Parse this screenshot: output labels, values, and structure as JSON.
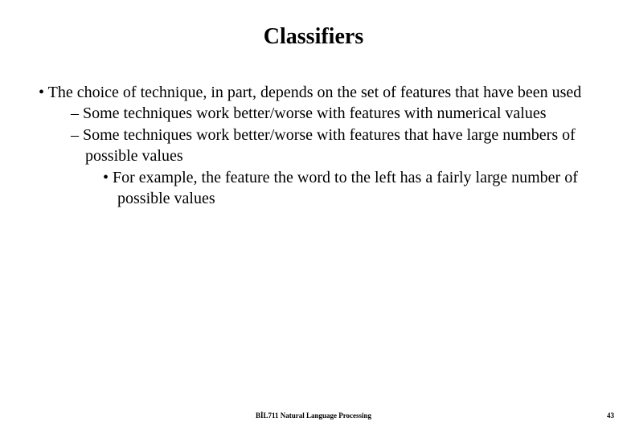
{
  "title": "Classifiers",
  "bullets": {
    "l1": "The choice of technique, in part, depends on the set of features that have been used",
    "l2a": "Some techniques work better/worse with features with numerical values",
    "l2b": "Some techniques work better/worse with features that have large numbers of possible values",
    "l3": "For example, the feature the word to the left has a fairly large number of possible values"
  },
  "footer": "BİL711 Natural Language Processing",
  "page_number": "43"
}
